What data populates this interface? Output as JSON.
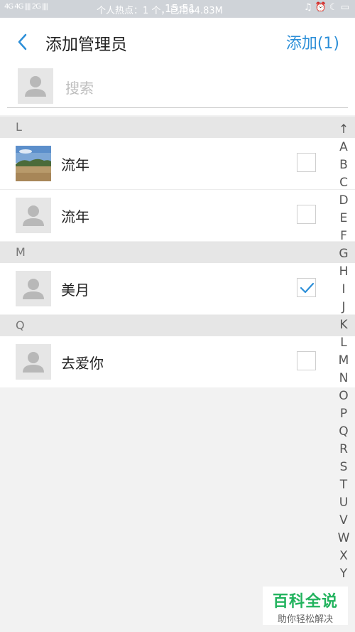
{
  "status_bar": {
    "signal_text": "4G 4G ‖‖ 2G ‖‖",
    "hotspot_text": "个人热点：1 个，已用64.83M",
    "time": "15:51",
    "icons": "♫ ⏰ ☾ ▭"
  },
  "header": {
    "title": "添加管理员",
    "add_label": "添加(1)"
  },
  "search": {
    "placeholder": "搜索",
    "value": ""
  },
  "sections": [
    {
      "letter": "L",
      "contacts": [
        {
          "name": "流年",
          "avatar": "landscape-photo",
          "checked": false
        },
        {
          "name": "流年",
          "avatar": "default-person",
          "checked": false
        }
      ]
    },
    {
      "letter": "M",
      "contacts": [
        {
          "name": "美月",
          "avatar": "default-person",
          "checked": true
        }
      ]
    },
    {
      "letter": "Q",
      "contacts": [
        {
          "name": "去爱你",
          "avatar": "default-person",
          "checked": false
        }
      ]
    }
  ],
  "index_bar": [
    "↑",
    "A",
    "B",
    "C",
    "D",
    "E",
    "F",
    "G",
    "H",
    "I",
    "J",
    "K",
    "L",
    "M",
    "N",
    "O",
    "P",
    "Q",
    "R",
    "S",
    "T",
    "U",
    "V",
    "W",
    "X",
    "Y"
  ],
  "watermark": {
    "main": "百科全说",
    "sub": "助你轻松解决"
  },
  "colors": {
    "accent": "#2d8fd8",
    "watermark": "#22b35e",
    "section_bg": "#e6e6e6"
  }
}
